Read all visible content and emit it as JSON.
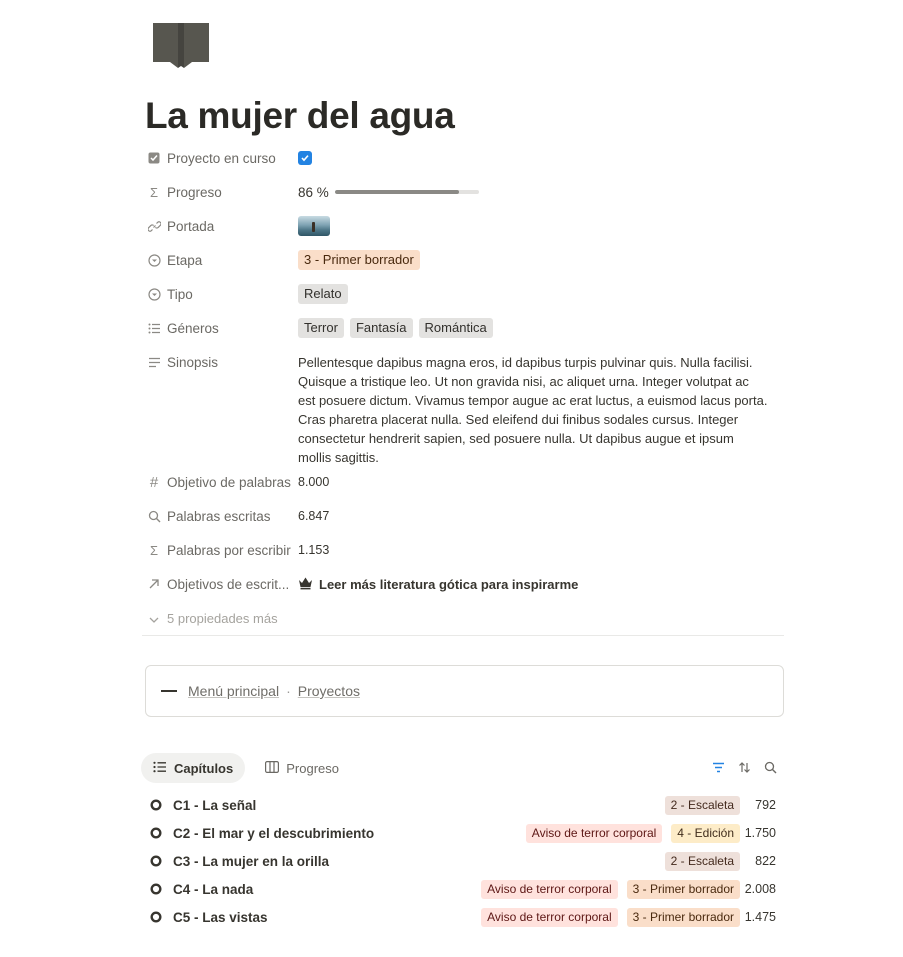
{
  "page": {
    "icon": "book-icon",
    "title": "La mujer del agua"
  },
  "properties": {
    "proyecto": {
      "label": "Proyecto en curso",
      "icon": "checkbox-icon",
      "checked": true
    },
    "progreso": {
      "label": "Progreso",
      "icon": "sigma-icon",
      "value": "86 %",
      "fraction": 0.86
    },
    "portada": {
      "label": "Portada",
      "icon": "link-icon"
    },
    "etapa": {
      "label": "Etapa",
      "icon": "select-icon",
      "value": "3 - Primer borrador",
      "color": "#fadec9"
    },
    "tipo": {
      "label": "Tipo",
      "icon": "select-icon",
      "value": "Relato"
    },
    "generos": {
      "label": "Géneros",
      "icon": "list-icon",
      "values": [
        "Terror",
        "Fantasía",
        "Romántica"
      ]
    },
    "sinopsis": {
      "label": "Sinopsis",
      "icon": "text-icon",
      "value": "Pellentesque dapibus magna eros, id dapibus turpis pulvinar quis. Nulla facilisi. Quisque a tristique leo. Ut non gravida nisi, ac aliquet urna. Integer volutpat ac est posuere dictum. Vivamus tempor augue ac erat luctus, a euismod lacus porta. Cras pharetra placerat nulla. Sed eleifend dui finibus sodales cursus. Integer consectetur hendrerit sapien, sed posuere nulla. Ut dapibus augue et ipsum mollis sagittis."
    },
    "objetivo": {
      "label": "Objetivo de palabras",
      "icon": "hash-icon",
      "value": "8.000"
    },
    "escritas": {
      "label": "Palabras escritas",
      "icon": "search-icon",
      "value": "6.847"
    },
    "porescribir": {
      "label": "Palabras por escribir",
      "icon": "sigma-icon",
      "value": "1.153"
    },
    "objetivos": {
      "label": "Objetivos de escrit...",
      "icon": "arrow-up-right-icon",
      "value": "Leer más literatura gótica para inspirarme",
      "value_icon": "crown-icon"
    },
    "more": {
      "label": "5 propiedades más"
    }
  },
  "callout": {
    "links": [
      "Menú principal",
      "Proyectos"
    ],
    "separator": "·"
  },
  "views": {
    "tabs": [
      {
        "label": "Capítulos",
        "icon": "list-icon",
        "active": true
      },
      {
        "label": "Progreso",
        "icon": "board-icon",
        "active": false
      }
    ],
    "tools": [
      "filter-icon",
      "sort-icon",
      "search-icon"
    ],
    "accent": "#2383e2"
  },
  "chapters": [
    {
      "title": "C1 - La señal",
      "tags": [
        {
          "text": "2 - Escaleta",
          "style": "brown"
        }
      ],
      "count": "792"
    },
    {
      "title": "C2 - El mar y el descubrimiento",
      "tags": [
        {
          "text": "Aviso de terror corporal",
          "style": "red"
        },
        {
          "text": "4 - Edición",
          "style": "yellow"
        }
      ],
      "count": "1.750"
    },
    {
      "title": "C3 - La mujer en la orilla",
      "tags": [
        {
          "text": "2 - Escaleta",
          "style": "brown"
        }
      ],
      "count": "822"
    },
    {
      "title": "C4 - La nada",
      "tags": [
        {
          "text": "Aviso de terror corporal",
          "style": "red"
        },
        {
          "text": "3 - Primer borrador",
          "style": "orange"
        }
      ],
      "count": "2.008"
    },
    {
      "title": "C5 - Las vistas",
      "tags": [
        {
          "text": "Aviso de terror corporal",
          "style": "red"
        },
        {
          "text": "3 - Primer borrador",
          "style": "orange"
        }
      ],
      "count": "1.475"
    }
  ]
}
